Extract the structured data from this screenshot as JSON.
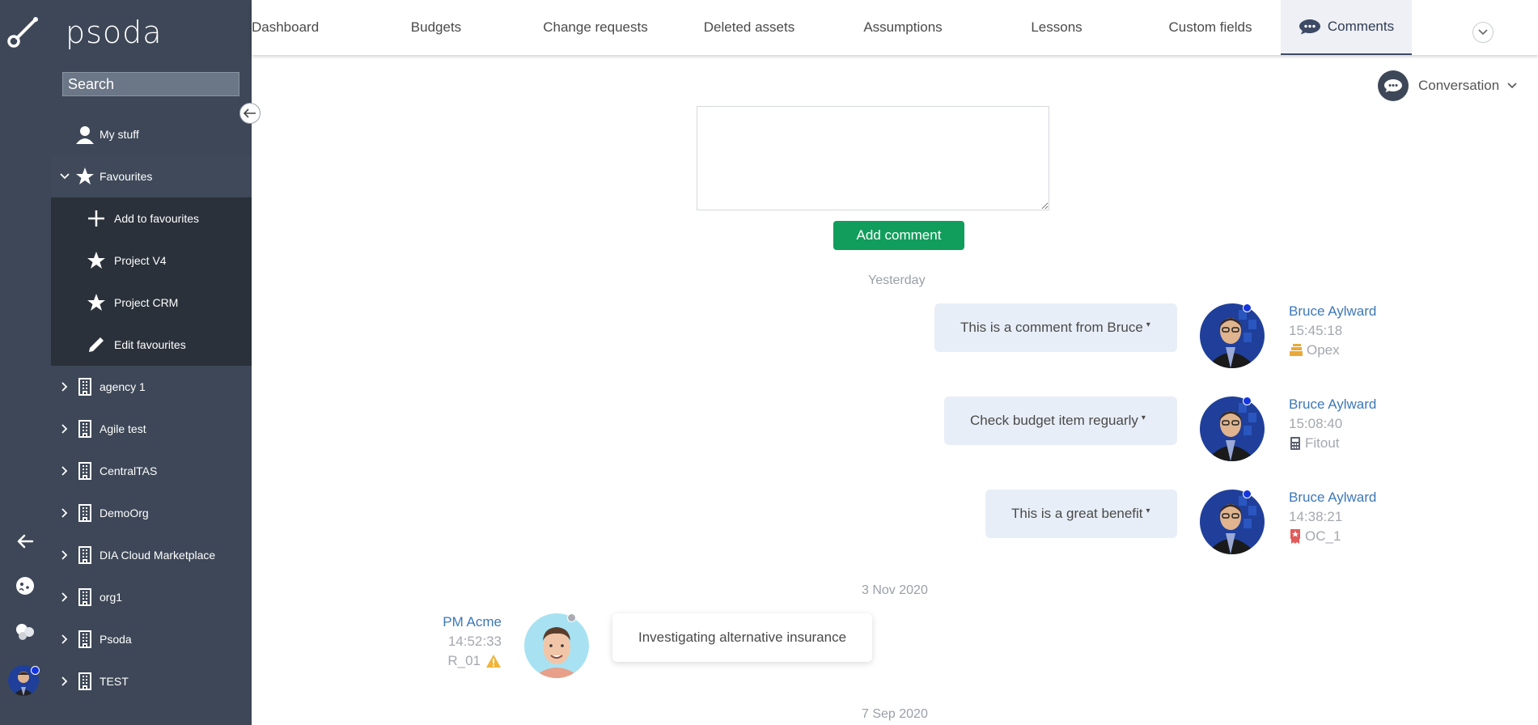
{
  "app": {
    "brand": "psoda"
  },
  "sidebar": {
    "search_placeholder": "Search",
    "items": [
      {
        "label": "My stuff"
      },
      {
        "label": "Favourites"
      },
      {
        "label": "Add to favourites"
      },
      {
        "label": "Project V4"
      },
      {
        "label": "Project CRM"
      },
      {
        "label": "Edit favourites"
      },
      {
        "label": "agency 1"
      },
      {
        "label": "Agile test"
      },
      {
        "label": "CentralTAS"
      },
      {
        "label": "DemoOrg"
      },
      {
        "label": "DIA Cloud Marketplace"
      },
      {
        "label": "org1"
      },
      {
        "label": "Psoda"
      },
      {
        "label": "TEST"
      }
    ]
  },
  "tabs": [
    {
      "label": "Dashboard"
    },
    {
      "label": "Budgets"
    },
    {
      "label": "Change requests"
    },
    {
      "label": "Deleted assets"
    },
    {
      "label": "Assumptions"
    },
    {
      "label": "Lessons"
    },
    {
      "label": "Custom fields"
    },
    {
      "label": "Comments",
      "active": true
    }
  ],
  "conversation": {
    "label": "Conversation"
  },
  "composer": {
    "placeholder": "",
    "button": "Add comment"
  },
  "date_groups": [
    "Yesterday",
    "3 Nov 2020",
    "7 Sep 2020"
  ],
  "comments": [
    {
      "text": "This is a comment from Bruce",
      "author": "Bruce Aylward",
      "time": "15:45:18",
      "tag": "Opex",
      "tag_icon": "budget-stack-icon",
      "tag_color": "#e8a93a"
    },
    {
      "text": "Check budget item reguarly",
      "author": "Bruce Aylward",
      "time": "15:08:40",
      "tag": "Fitout",
      "tag_icon": "calculator-icon",
      "tag_color": "#5a6070"
    },
    {
      "text": "This is a great benefit",
      "author": "Bruce Aylward",
      "time": "14:38:21",
      "tag": "OC_1",
      "tag_icon": "benefit-ribbon-icon",
      "tag_color": "#e35a5a"
    },
    {
      "text": "Investigating alternative insurance",
      "author": "PM Acme",
      "time": "14:52:33",
      "tag": "R_01",
      "tag_icon": "warning-icon",
      "tag_color": "#f0b43a"
    }
  ],
  "colors": {
    "sidebar_bg": "#3d4757",
    "accent_green": "#119d5c",
    "link_blue": "#3d78b8",
    "online_dot": "#1535e0"
  }
}
